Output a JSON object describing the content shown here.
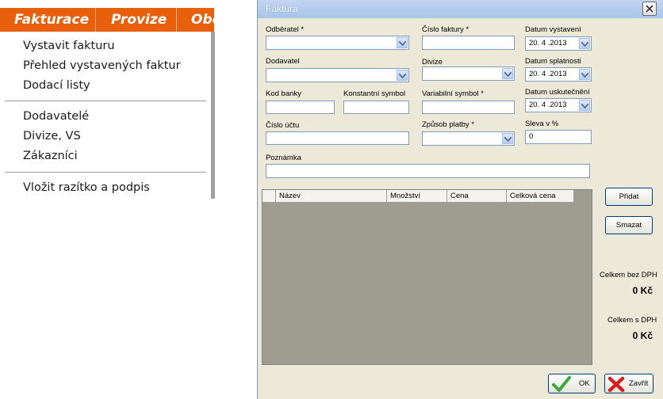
{
  "menu": {
    "tabs": [
      "Fakturace",
      "Provize",
      "Obě"
    ],
    "items": [
      "Vystavit fakturu",
      "Přehled vystavených faktur",
      "Dodací listy",
      "Dodavatelé",
      "Divize, VS",
      "Zákazníci",
      "Vložit razítko a podpis"
    ]
  },
  "dialog": {
    "title": "Faktura",
    "labels": {
      "odberatel": "Odběratel *",
      "cislo_faktury": "Číslo faktury *",
      "datum_vystaveni": "Datum vystavení",
      "dodavatel": "Dodavatel",
      "divize": "Divize",
      "datum_splatnosti": "Datum splatnosti",
      "kod_banky": "Kod banky",
      "konstantni_symbol": "Konstantní symbol",
      "variabilni_symbol": "Variabilní symbol *",
      "datum_uskutecneni": "Datum uskutečnění",
      "cislo_uctu": "Číslo účtu",
      "zpusob_platby": "Způsob platby *",
      "sleva": "Sleva v %",
      "poznamka": "Poznámka"
    },
    "values": {
      "datum_vystaveni": "20. 4 .2013",
      "datum_splatnosti": "20. 4 .2013",
      "datum_uskutecneni": "20. 4 .2013",
      "sleva": "0"
    },
    "grid_columns": [
      "Název",
      "Množství",
      "Cena",
      "Celková cena"
    ],
    "buttons": {
      "pridat": "Přidat",
      "smazat": "Smazat",
      "ok": "OK",
      "zavrit": "Zavřít"
    },
    "totals": {
      "bez_dph_label": "Celkem bez DPH",
      "bez_dph_value": "0 Kč",
      "s_dph_label": "Celkem s DPH",
      "s_dph_value": "0 Kč"
    }
  },
  "colors": {
    "menu_orange": "#e8600c",
    "dialog_bg": "#ece9d8",
    "grid_bg": "#9f9c90"
  }
}
